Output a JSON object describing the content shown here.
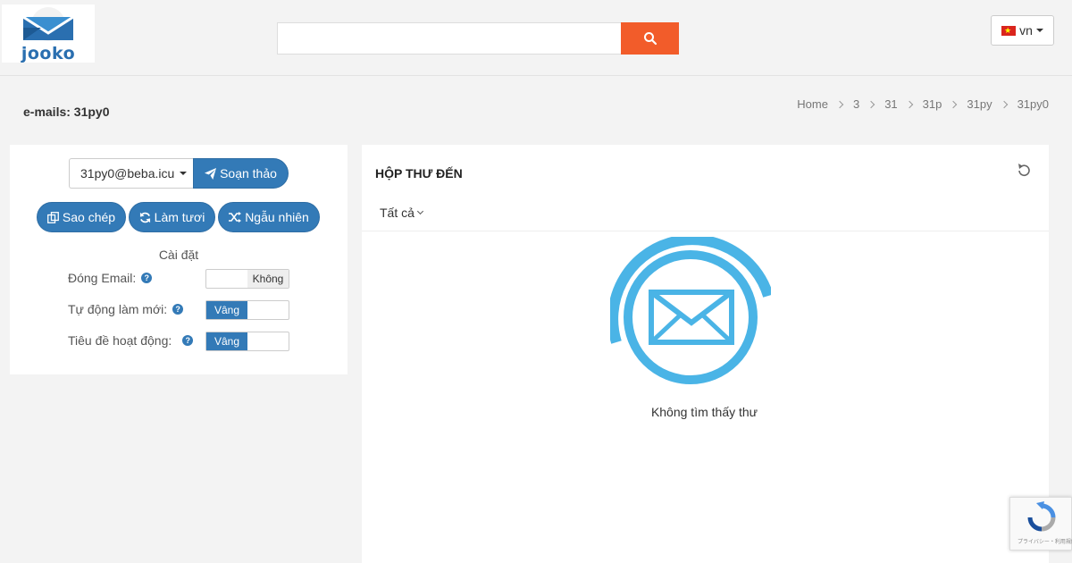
{
  "header": {
    "logo_text": "jooko",
    "search_placeholder": "",
    "language": "vn"
  },
  "page": {
    "title": "e-mails: 31py0",
    "breadcrumb": [
      "Home",
      "3",
      "31",
      "31p",
      "31py",
      "31py0"
    ]
  },
  "left_panel": {
    "email_address": "31py0@beba.icu",
    "compose_label": "Soạn thảo",
    "copy_label": "Sao chép",
    "refresh_label": "Làm tươi",
    "random_label": "Ngẫu nhiên",
    "settings_title": "Cài đặt",
    "settings": [
      {
        "label": "Đóng Email:",
        "state_label": "Không",
        "on": false
      },
      {
        "label": "Tự động làm mới:",
        "state_label": "Vâng",
        "on": true
      },
      {
        "label": "Tiêu đề hoạt động:",
        "state_label": "Vâng",
        "on": true
      }
    ]
  },
  "inbox": {
    "title": "HỘP THƯ ĐẾN",
    "filter_label": "Tất cả",
    "empty_message": "Không tìm thấy thư"
  },
  "recaptcha": {
    "terms": "プライバシー・利用規約"
  },
  "colors": {
    "primary": "#337ab7",
    "search_button": "#f25c2a",
    "envelope": "#4ab4e6"
  }
}
